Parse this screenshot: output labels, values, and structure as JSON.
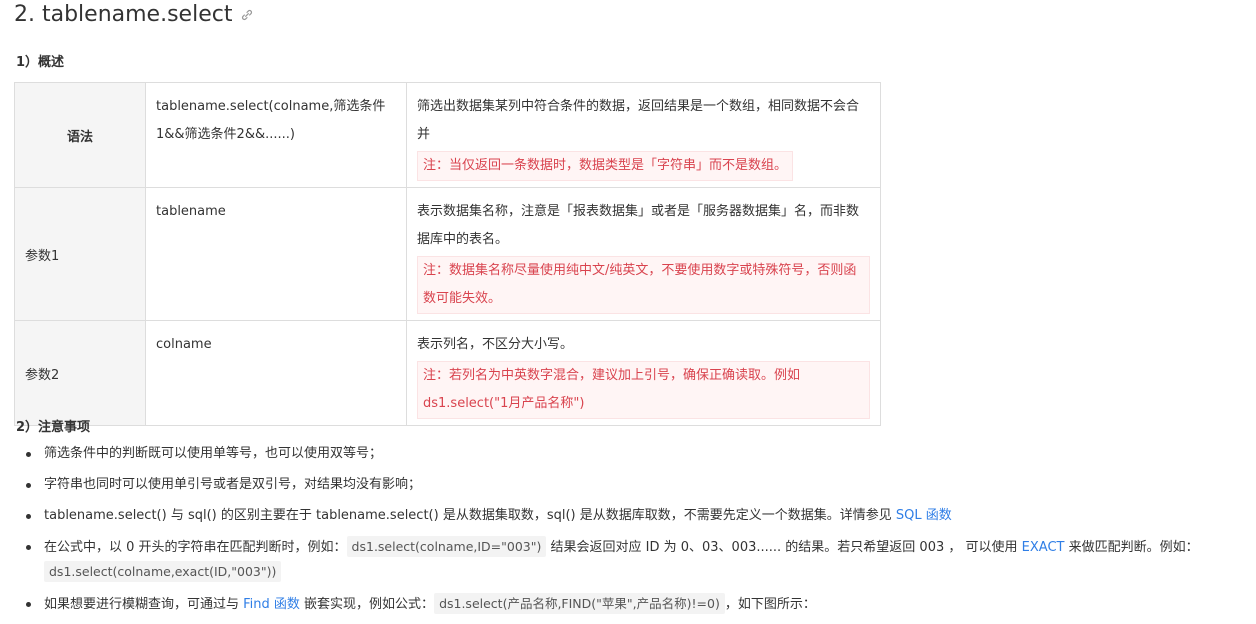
{
  "title": "2. tablename.select",
  "section1": "1）概述",
  "section2": "2）注意事项",
  "table": {
    "rows": [
      {
        "label": "语法",
        "param": "tablename.select(colname,筛选条件1&&筛选条件2&&......)",
        "desc": "筛选出数据集某列中符合条件的数据，返回结果是一个数组，相同数据不会合并",
        "note": "注：当仅返回一条数据时，数据类型是「字符串」而不是数组。"
      },
      {
        "label": "参数1",
        "param": "tablename",
        "desc": "表示数据集名称，注意是「报表数据集」或者是「服务器数据集」名，而非数据库中的表名。",
        "note": "注：数据集名称尽量使用纯中文/纯英文，不要使用数字或特殊符号，否则函数可能失效。"
      },
      {
        "label": "参数2",
        "param": "colname",
        "desc": "表示列名，不区分大小写。",
        "note": "注：若列名为中英数字混合，建议加上引号，确保正确读取。例如ds1.select(\"1月产品名称\")"
      }
    ]
  },
  "tips": {
    "t1": "筛选条件中的判断既可以使用单等号，也可以使用双等号；",
    "t2": "字符串也同时可以使用单引号或者是双引号，对结果均没有影响；",
    "t3_text": "tablename.select() 与 sql() 的区别主要在于 tablename.select() 是从数据集取数，sql() 是从数据库取数，不需要先定义一个数据集。详情参见 ",
    "t3_link": "SQL 函数",
    "t4_a": "在公式中，以 0 开头的字符串在匹配判断时，例如：",
    "t4_code1": "ds1.select(colname,ID=\"003\")",
    "t4_b": " 结果会返回对应 ID 为 0、03、003...... 的结果。若只希望返回 003 ， 可以使用 ",
    "t4_link": "EXACT",
    "t4_c": " 来做匹配判断。例如：",
    "t4_code2": "ds1.select(colname,exact(ID,\"003\"))",
    "t5_a": "如果想要进行模糊查询，可通过与 ",
    "t5_link": "Find 函数",
    "t5_b": " 嵌套实现，例如公式：",
    "t5_code": "ds1.select(产品名称,FIND(\"苹果\",产品名称)!=0)",
    "t5_c": "，如下图所示："
  },
  "colors": {
    "link": "#2f7ee6",
    "note_text": "#d9434e",
    "note_bg": "#fff5f5"
  }
}
